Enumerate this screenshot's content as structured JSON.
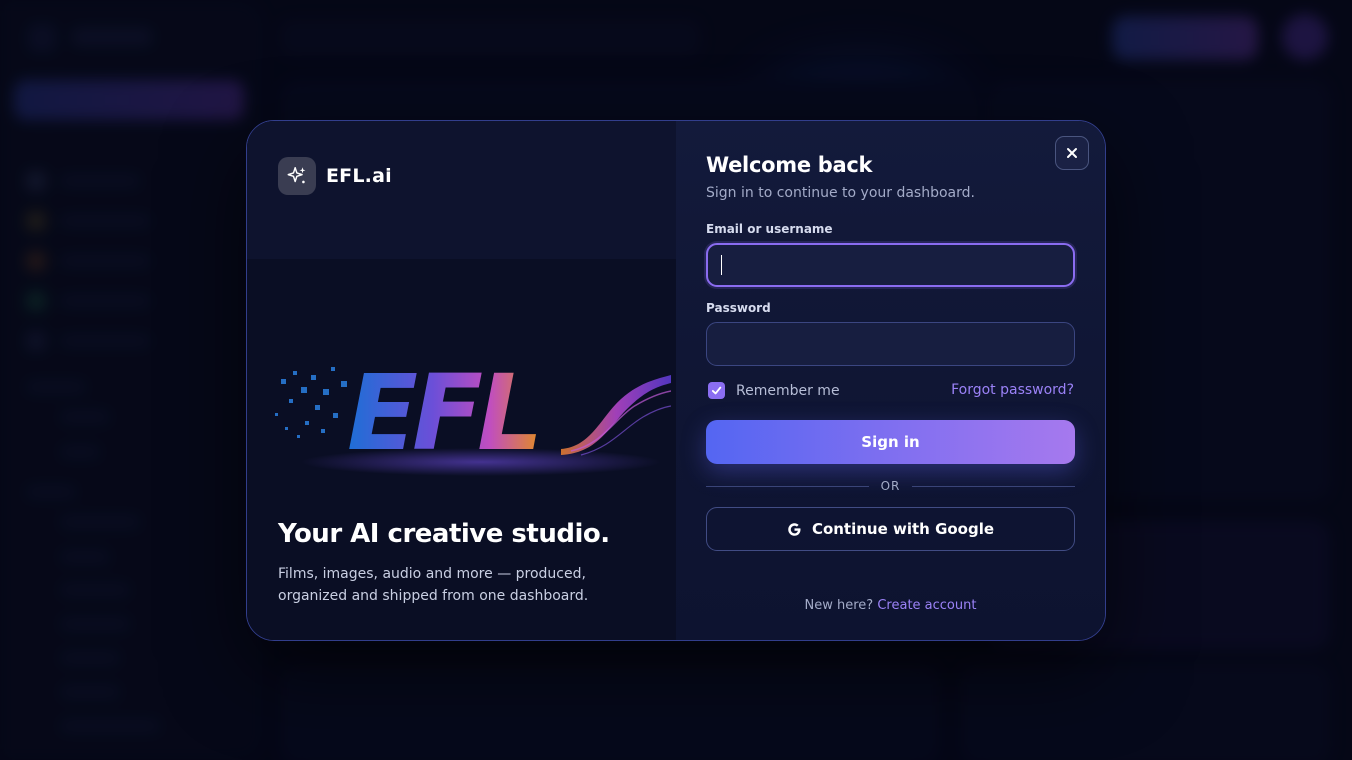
{
  "brand": {
    "name": "EFL.ai",
    "icon": "sparkle-icon"
  },
  "hero": {
    "art_text": "EFL"
  },
  "tagline": {
    "title": "Your AI creative studio.",
    "body": "Films, images, audio and more — produced, organized and shipped from one dashboard."
  },
  "login": {
    "title": "Welcome back",
    "subtitle": "Sign in to continue to your dashboard.",
    "email_label": "Email or username",
    "email_value": "",
    "password_label": "Password",
    "password_value": "",
    "remember_label": "Remember me",
    "remember_checked": true,
    "forgot_label": "Forgot password?",
    "signin_label": "Sign in",
    "divider_label": "OR",
    "google_label": "Continue with Google",
    "signup_prompt": "New here?",
    "signup_link": "Create account",
    "close_icon": "close-icon"
  },
  "colors": {
    "accent": "#8b6ef2",
    "button_gradient_start": "#5466f2",
    "button_gradient_end": "#a679ee",
    "link": "#9b82f7"
  }
}
